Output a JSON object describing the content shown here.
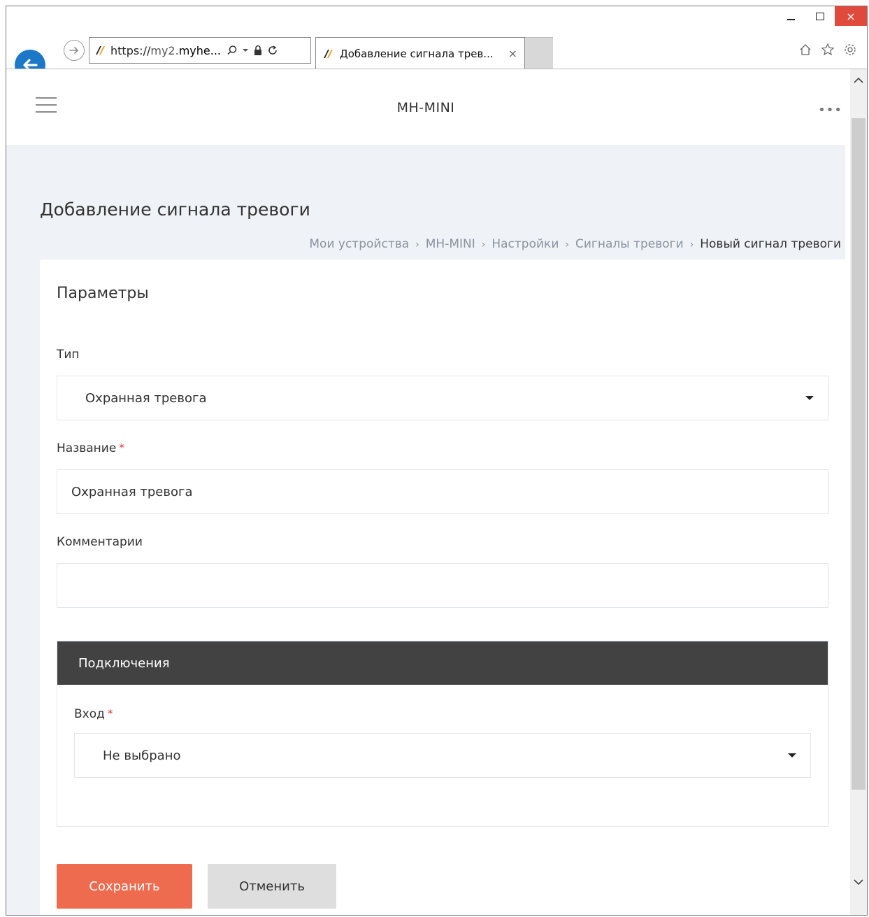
{
  "browser": {
    "address": {
      "scheme": "https://",
      "host_dim": "my2.",
      "host_bold": "myhe..."
    },
    "tab": {
      "title": "Добавление сигнала трев...",
      "close_glyph": "×"
    },
    "window_controls": {
      "close_glyph": "×"
    },
    "toolbar_icons": [
      "home-icon",
      "star-icon",
      "gear-icon"
    ]
  },
  "app": {
    "device_name": "MH-MINI",
    "more_glyph": "•••"
  },
  "page": {
    "title": "Добавление сигнала тревоги",
    "breadcrumb": [
      "Мои устройства",
      "MH-MINI",
      "Настройки",
      "Сигналы тревоги",
      "Новый сигнал тревоги"
    ],
    "breadcrumb_separator": "›"
  },
  "form": {
    "section_title": "Параметры",
    "type": {
      "label": "Тип",
      "value": "Охранная тревога"
    },
    "name": {
      "label": "Название",
      "required_mark": "*",
      "value": "Охранная тревога"
    },
    "comments": {
      "label": "Комментарии",
      "value": ""
    },
    "connections": {
      "header": "Подключения",
      "input": {
        "label": "Вход",
        "required_mark": "*",
        "value": "Не выбрано"
      }
    },
    "save_label": "Сохранить",
    "cancel_label": "Отменить"
  },
  "colors": {
    "primary_button": "#ee6b4f",
    "back_button": "#1e78c8",
    "panel_header": "#424242",
    "required": "#e03030",
    "close_button": "#e04a3c"
  }
}
